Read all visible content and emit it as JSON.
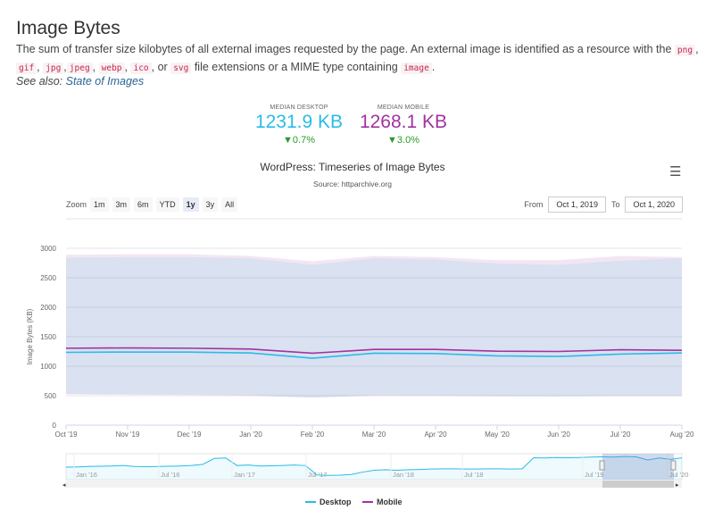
{
  "header": {
    "title": "Image Bytes",
    "desc_parts": [
      "The sum of transfer size kilobytes of all external images requested by the page. An external image is identified as a resource with the ",
      ", ",
      ", ",
      ",",
      ", ",
      ", ",
      ", or ",
      " file extensions or a MIME type containing ",
      "."
    ],
    "codes": [
      "png",
      "gif",
      "jpg",
      "jpeg",
      "webp",
      "ico",
      "svg",
      "image"
    ],
    "see_also_label": "See also:",
    "see_also_link": "State of Images"
  },
  "stats": [
    {
      "label": "MEDIAN DESKTOP",
      "value": "1231.9 KB",
      "change": "▼0.7%",
      "color": "#2bbbe8"
    },
    {
      "label": "MEDIAN MOBILE",
      "value": "1268.1 KB",
      "change": "▼3.0%",
      "color": "#a033a0"
    }
  ],
  "controls": {
    "zoom_label": "Zoom",
    "zoom_buttons": [
      "1m",
      "3m",
      "6m",
      "YTD",
      "1y",
      "3y",
      "All"
    ],
    "selected": "1y",
    "from_label": "From",
    "from": "Oct 1, 2019",
    "to_label": "To",
    "to": "Oct 1, 2020"
  },
  "chart_data": {
    "type": "line",
    "title": "WordPress: Timeseries of Image Bytes",
    "subtitle": "Source: httparchive.org",
    "ylabel": "Image Bytes (KB)",
    "ylim": [
      0,
      3000
    ],
    "yticks": [
      0,
      500,
      1000,
      1500,
      2000,
      2500,
      3000
    ],
    "x": [
      "Oct '19",
      "Nov '19",
      "Dec '19",
      "Jan '20",
      "Feb '20",
      "Mar '20",
      "Apr '20",
      "May '20",
      "Jun '20",
      "Jul '20",
      "Aug '20"
    ],
    "grid": true,
    "legend": "bottom",
    "series": [
      {
        "name": "Desktop",
        "color": "#2bbbe8",
        "values": [
          1235,
          1240,
          1240,
          1225,
          1135,
          1220,
          1215,
          1175,
          1165,
          1205,
          1225
        ],
        "band_high": [
          2840,
          2850,
          2850,
          2830,
          2720,
          2830,
          2810,
          2740,
          2720,
          2790,
          2830
        ],
        "band_low": [
          530,
          520,
          515,
          505,
          460,
          505,
          500,
          490,
          485,
          495,
          495
        ]
      },
      {
        "name": "Mobile",
        "color": "#a033a0",
        "values": [
          1305,
          1310,
          1305,
          1290,
          1220,
          1285,
          1285,
          1255,
          1250,
          1280,
          1270
        ],
        "band_high": [
          2890,
          2900,
          2900,
          2870,
          2780,
          2870,
          2850,
          2800,
          2800,
          2870,
          2850
        ],
        "band_low": [
          520,
          515,
          510,
          500,
          470,
          500,
          500,
          490,
          490,
          495,
          495
        ]
      }
    ],
    "navigator": {
      "xticks": [
        "Jan '16",
        "Jul '16",
        "Jan '17",
        "Jul '17",
        "Jan '18",
        "Jul '18",
        "Jul '19",
        "Jul '20"
      ],
      "values": [
        830,
        840,
        860,
        870,
        880,
        900,
        860,
        850,
        860,
        870,
        880,
        900,
        950,
        1200,
        1220,
        900,
        920,
        880,
        890,
        900,
        920,
        900,
        500,
        480,
        490,
        520,
        620,
        700,
        720,
        700,
        720,
        730,
        750,
        760,
        760,
        750,
        750,
        760,
        760,
        750,
        760,
        1230,
        1220,
        1240,
        1230,
        1240,
        1260,
        1270,
        1260,
        1280,
        1265,
        1135,
        1220,
        1165,
        1225
      ],
      "selection": [
        "Oct '19",
        "Aug '20"
      ]
    }
  }
}
